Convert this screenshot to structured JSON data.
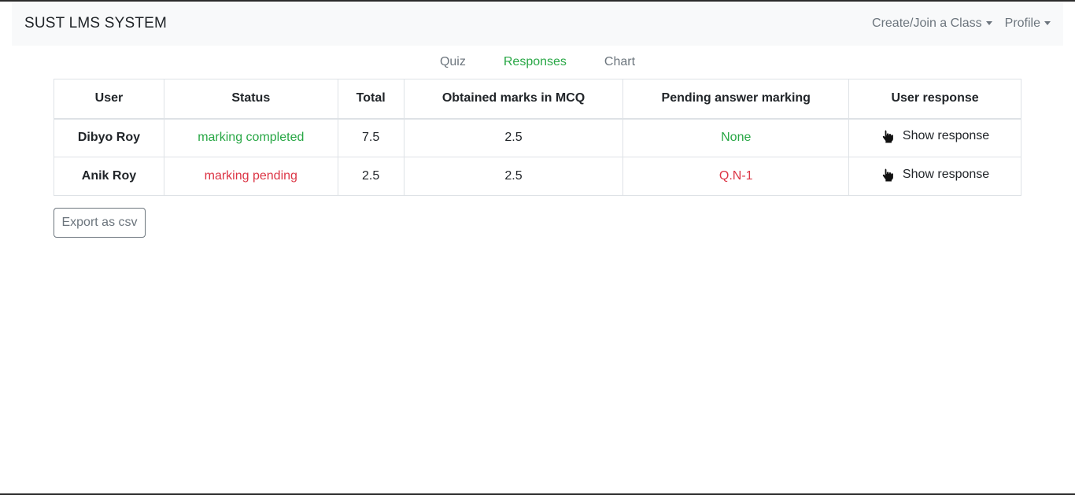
{
  "navbar": {
    "brand": "SUST LMS SYSTEM",
    "create_join": "Create/Join a Class",
    "profile": "Profile"
  },
  "tabs": [
    {
      "label": "Quiz",
      "active": false
    },
    {
      "label": "Responses",
      "active": true
    },
    {
      "label": "Chart",
      "active": false
    }
  ],
  "table": {
    "headers": [
      "User",
      "Status",
      "Total",
      "Obtained marks in MCQ",
      "Pending answer marking",
      "User response"
    ],
    "rows": [
      {
        "user": "Dibyo Roy",
        "status": "marking completed",
        "total": "7.5",
        "mcq": "2.5",
        "pending": "None",
        "action": "Show response",
        "state": "completed"
      },
      {
        "user": "Anik Roy",
        "status": "marking pending",
        "total": "2.5",
        "mcq": "2.5",
        "pending": "Q.N-1",
        "action": "Show response",
        "state": "pending"
      }
    ]
  },
  "export_label": "Export as csv",
  "colors": {
    "completed": "#28a745",
    "pending": "#dc3545"
  },
  "icons": {
    "show_response": "hand-pointer-icon"
  }
}
